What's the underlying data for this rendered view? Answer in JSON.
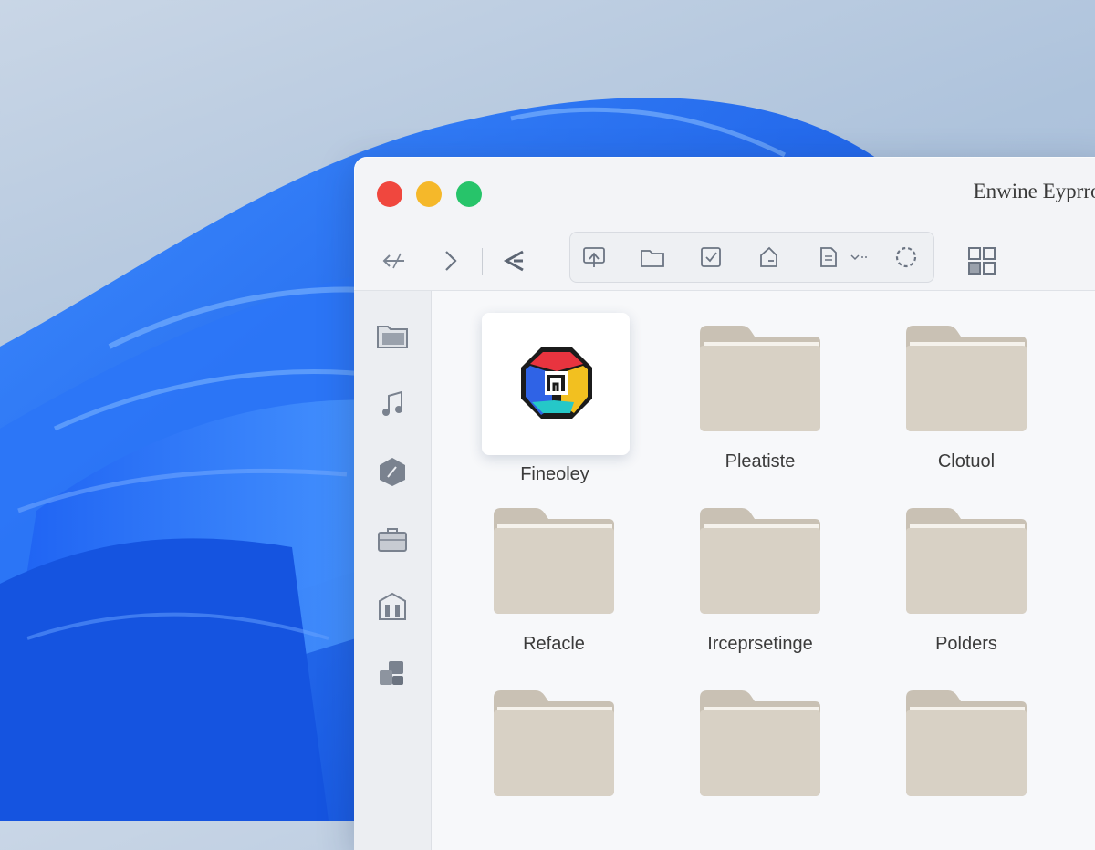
{
  "window": {
    "title": "Enwine Eyprron"
  },
  "toolbar": {
    "buttons": [
      "back-icon",
      "forward-icon",
      "share-icon",
      "new-folder-icon",
      "folder-icon",
      "checkbox-icon",
      "tag-icon",
      "document-icon",
      "more-icon",
      "settings-icon",
      "grid-view-icon"
    ]
  },
  "sidebar": {
    "items": [
      "folder-icon",
      "music-icon",
      "tag-icon",
      "briefcase-icon",
      "building-icon",
      "apps-icon"
    ]
  },
  "files": {
    "items": [
      {
        "label": "Fineoley",
        "type": "app",
        "selected": true
      },
      {
        "label": "Pleatiste",
        "type": "folder"
      },
      {
        "label": "Clotuol",
        "type": "folder"
      },
      {
        "label": "Refacle",
        "type": "folder"
      },
      {
        "label": "Irceprsetinge",
        "type": "folder"
      },
      {
        "label": "Polders",
        "type": "folder"
      },
      {
        "label": "",
        "type": "folder"
      },
      {
        "label": "",
        "type": "folder"
      },
      {
        "label": "",
        "type": "folder"
      }
    ]
  },
  "colors": {
    "close": "#f0473e",
    "minimize": "#f5b82a",
    "maximize": "#27c46a",
    "accent": "#1f6ff0",
    "folder": "#d6cfc3"
  }
}
